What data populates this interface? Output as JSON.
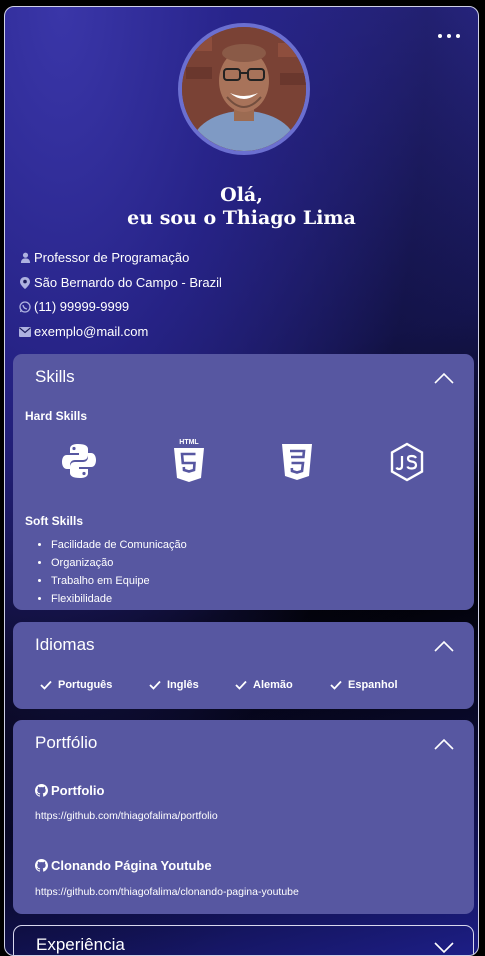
{
  "profile": {
    "greeting_line1": "Olá,",
    "greeting_line2": "eu sou o Thiago Lima",
    "job": "Professor de Programação",
    "location": "São Bernardo do Campo - Brazil",
    "phone": "(11) 99999-9999",
    "email": "exemplo@mail.com"
  },
  "skills": {
    "title": "Skills",
    "hard_title": "Hard Skills",
    "hard_icons": [
      "python-icon",
      "html5-icon",
      "css3-icon",
      "nodejs-icon"
    ],
    "html5_badge": "HTML",
    "soft_title": "Soft Skills",
    "soft_items": [
      "Facilidade de Comunicação",
      "Organização",
      "Trabalho em Equipe",
      "Flexibilidade"
    ]
  },
  "languages": {
    "title": "Idiomas",
    "items": [
      "Português",
      "Inglês",
      "Alemão",
      "Espanhol"
    ]
  },
  "portfolio": {
    "title": "Portfólio",
    "projects": [
      {
        "name": "Portfolio",
        "url": "https://github.com/thiagofalima/portfolio"
      },
      {
        "name": "Clonando Página Youtube",
        "url": "https://github.com/thiagofalima/clonando-pagina-youtube"
      }
    ]
  },
  "experience": {
    "title": "Experiência"
  },
  "colors": {
    "card": "#5757a1",
    "avatar_border": "#6b6fd0",
    "accent": "#2f2c96"
  }
}
